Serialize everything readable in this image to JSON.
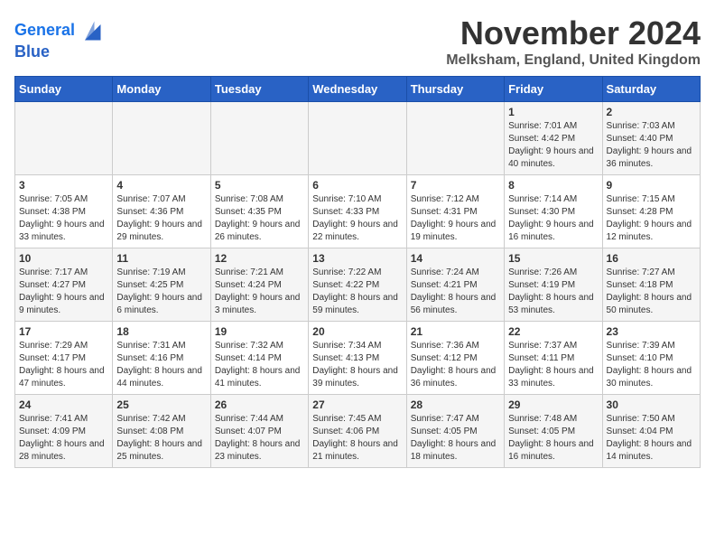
{
  "logo": {
    "line1": "General",
    "line2": "Blue"
  },
  "title": "November 2024",
  "location": "Melksham, England, United Kingdom",
  "days_header": [
    "Sunday",
    "Monday",
    "Tuesday",
    "Wednesday",
    "Thursday",
    "Friday",
    "Saturday"
  ],
  "weeks": [
    [
      {
        "day": "",
        "info": ""
      },
      {
        "day": "",
        "info": ""
      },
      {
        "day": "",
        "info": ""
      },
      {
        "day": "",
        "info": ""
      },
      {
        "day": "",
        "info": ""
      },
      {
        "day": "1",
        "info": "Sunrise: 7:01 AM\nSunset: 4:42 PM\nDaylight: 9 hours and 40 minutes."
      },
      {
        "day": "2",
        "info": "Sunrise: 7:03 AM\nSunset: 4:40 PM\nDaylight: 9 hours and 36 minutes."
      }
    ],
    [
      {
        "day": "3",
        "info": "Sunrise: 7:05 AM\nSunset: 4:38 PM\nDaylight: 9 hours and 33 minutes."
      },
      {
        "day": "4",
        "info": "Sunrise: 7:07 AM\nSunset: 4:36 PM\nDaylight: 9 hours and 29 minutes."
      },
      {
        "day": "5",
        "info": "Sunrise: 7:08 AM\nSunset: 4:35 PM\nDaylight: 9 hours and 26 minutes."
      },
      {
        "day": "6",
        "info": "Sunrise: 7:10 AM\nSunset: 4:33 PM\nDaylight: 9 hours and 22 minutes."
      },
      {
        "day": "7",
        "info": "Sunrise: 7:12 AM\nSunset: 4:31 PM\nDaylight: 9 hours and 19 minutes."
      },
      {
        "day": "8",
        "info": "Sunrise: 7:14 AM\nSunset: 4:30 PM\nDaylight: 9 hours and 16 minutes."
      },
      {
        "day": "9",
        "info": "Sunrise: 7:15 AM\nSunset: 4:28 PM\nDaylight: 9 hours and 12 minutes."
      }
    ],
    [
      {
        "day": "10",
        "info": "Sunrise: 7:17 AM\nSunset: 4:27 PM\nDaylight: 9 hours and 9 minutes."
      },
      {
        "day": "11",
        "info": "Sunrise: 7:19 AM\nSunset: 4:25 PM\nDaylight: 9 hours and 6 minutes."
      },
      {
        "day": "12",
        "info": "Sunrise: 7:21 AM\nSunset: 4:24 PM\nDaylight: 9 hours and 3 minutes."
      },
      {
        "day": "13",
        "info": "Sunrise: 7:22 AM\nSunset: 4:22 PM\nDaylight: 8 hours and 59 minutes."
      },
      {
        "day": "14",
        "info": "Sunrise: 7:24 AM\nSunset: 4:21 PM\nDaylight: 8 hours and 56 minutes."
      },
      {
        "day": "15",
        "info": "Sunrise: 7:26 AM\nSunset: 4:19 PM\nDaylight: 8 hours and 53 minutes."
      },
      {
        "day": "16",
        "info": "Sunrise: 7:27 AM\nSunset: 4:18 PM\nDaylight: 8 hours and 50 minutes."
      }
    ],
    [
      {
        "day": "17",
        "info": "Sunrise: 7:29 AM\nSunset: 4:17 PM\nDaylight: 8 hours and 47 minutes."
      },
      {
        "day": "18",
        "info": "Sunrise: 7:31 AM\nSunset: 4:16 PM\nDaylight: 8 hours and 44 minutes."
      },
      {
        "day": "19",
        "info": "Sunrise: 7:32 AM\nSunset: 4:14 PM\nDaylight: 8 hours and 41 minutes."
      },
      {
        "day": "20",
        "info": "Sunrise: 7:34 AM\nSunset: 4:13 PM\nDaylight: 8 hours and 39 minutes."
      },
      {
        "day": "21",
        "info": "Sunrise: 7:36 AM\nSunset: 4:12 PM\nDaylight: 8 hours and 36 minutes."
      },
      {
        "day": "22",
        "info": "Sunrise: 7:37 AM\nSunset: 4:11 PM\nDaylight: 8 hours and 33 minutes."
      },
      {
        "day": "23",
        "info": "Sunrise: 7:39 AM\nSunset: 4:10 PM\nDaylight: 8 hours and 30 minutes."
      }
    ],
    [
      {
        "day": "24",
        "info": "Sunrise: 7:41 AM\nSunset: 4:09 PM\nDaylight: 8 hours and 28 minutes."
      },
      {
        "day": "25",
        "info": "Sunrise: 7:42 AM\nSunset: 4:08 PM\nDaylight: 8 hours and 25 minutes."
      },
      {
        "day": "26",
        "info": "Sunrise: 7:44 AM\nSunset: 4:07 PM\nDaylight: 8 hours and 23 minutes."
      },
      {
        "day": "27",
        "info": "Sunrise: 7:45 AM\nSunset: 4:06 PM\nDaylight: 8 hours and 21 minutes."
      },
      {
        "day": "28",
        "info": "Sunrise: 7:47 AM\nSunset: 4:05 PM\nDaylight: 8 hours and 18 minutes."
      },
      {
        "day": "29",
        "info": "Sunrise: 7:48 AM\nSunset: 4:05 PM\nDaylight: 8 hours and 16 minutes."
      },
      {
        "day": "30",
        "info": "Sunrise: 7:50 AM\nSunset: 4:04 PM\nDaylight: 8 hours and 14 minutes."
      }
    ]
  ]
}
